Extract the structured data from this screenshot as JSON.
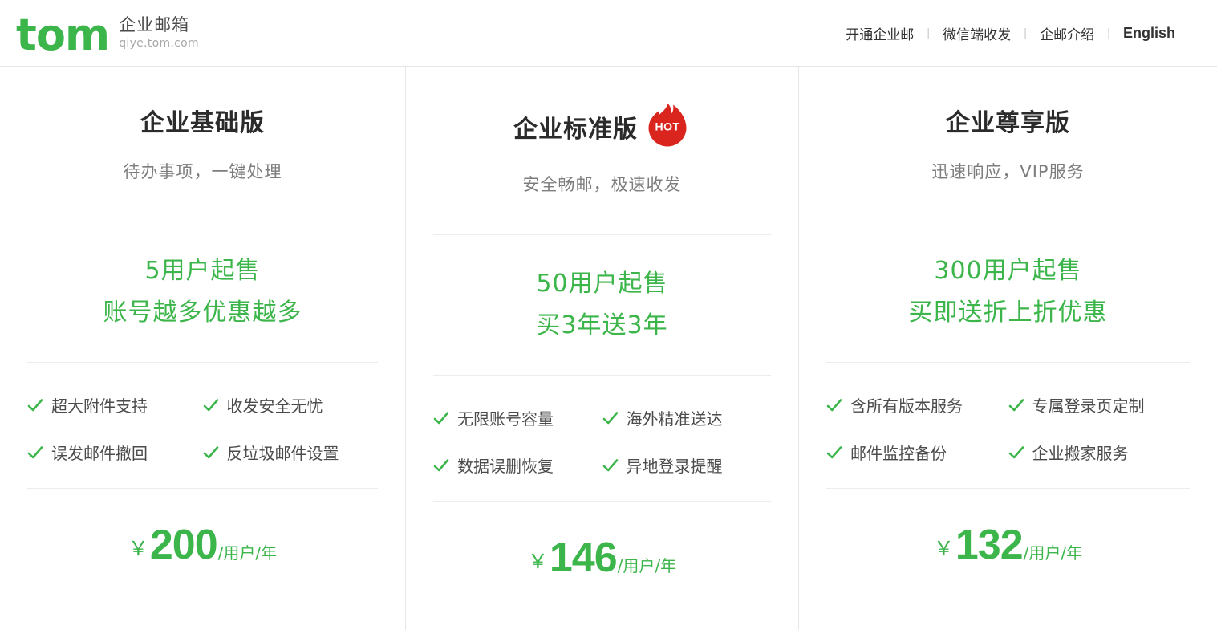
{
  "header": {
    "logo_text": "tom",
    "brand_cn": "企业邮箱",
    "brand_url": "qiye.tom.com",
    "nav": [
      {
        "label": "开通企业邮"
      },
      {
        "label": "微信端收发"
      },
      {
        "label": "企邮介绍"
      },
      {
        "label": "English"
      }
    ],
    "separator": "|"
  },
  "colors": {
    "brand_green": "#3cb54b",
    "hot_red": "#d9251d",
    "title_dark": "#2b2b2b",
    "subtitle_gray": "#7d7d7d",
    "divider": "#ececec"
  },
  "plans": [
    {
      "title": "企业基础版",
      "badge": null,
      "subtitle": "待办事项，一键处理",
      "promo": [
        "5用户起售",
        "账号越多优惠越多"
      ],
      "features": [
        "超大附件支持",
        "收发安全无忧",
        "误发邮件撤回",
        "反垃圾邮件设置"
      ],
      "price": {
        "currency": "￥",
        "amount": "200",
        "unit": "/用户/年"
      }
    },
    {
      "title": "企业标准版",
      "badge": "HOT",
      "subtitle": "安全畅邮，极速收发",
      "promo": [
        "50用户起售",
        "买3年送3年"
      ],
      "features": [
        "无限账号容量",
        "海外精准送达",
        "数据误删恢复",
        "异地登录提醒"
      ],
      "price": {
        "currency": "￥",
        "amount": "146",
        "unit": "/用户/年"
      }
    },
    {
      "title": "企业尊享版",
      "badge": null,
      "subtitle": "迅速响应，VIP服务",
      "promo": [
        "300用户起售",
        "买即送折上折优惠"
      ],
      "features": [
        "含所有版本服务",
        "专属登录页定制",
        "邮件监控备份",
        "企业搬家服务"
      ],
      "price": {
        "currency": "￥",
        "amount": "132",
        "unit": "/用户/年"
      }
    }
  ]
}
